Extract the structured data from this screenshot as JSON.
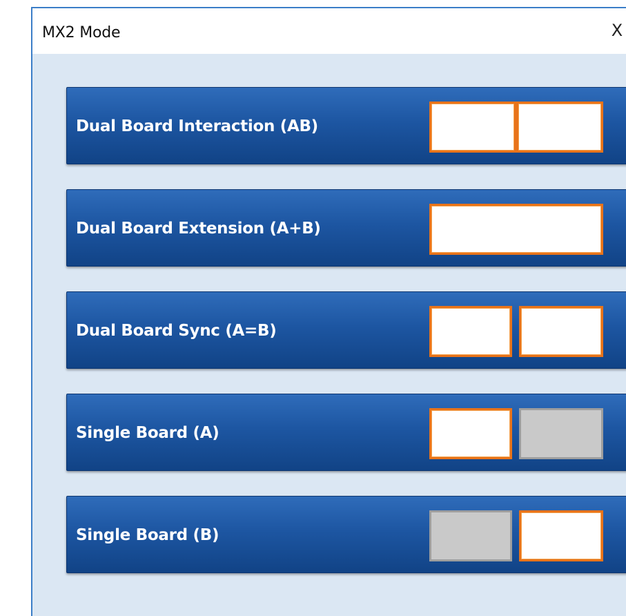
{
  "window": {
    "title": "MX2 Mode",
    "close_glyph": "X"
  },
  "modes": [
    {
      "label": "Dual Board Interaction (AB)",
      "icon": "dual-board-interaction-icon"
    },
    {
      "label": "Dual Board Extension (A+B)",
      "icon": "dual-board-extension-icon"
    },
    {
      "label": "Dual Board Sync (A=B)",
      "icon": "dual-board-sync-icon"
    },
    {
      "label": "Single Board (A)",
      "icon": "single-board-a-icon"
    },
    {
      "label": "Single Board (B)",
      "icon": "single-board-b-icon"
    }
  ],
  "colors": {
    "button_blue": "#1d56a2",
    "board_border_orange": "#e8731a",
    "arrow_navy": "#1a3d7c",
    "inactive_board_gray": "#c9c9c9"
  }
}
